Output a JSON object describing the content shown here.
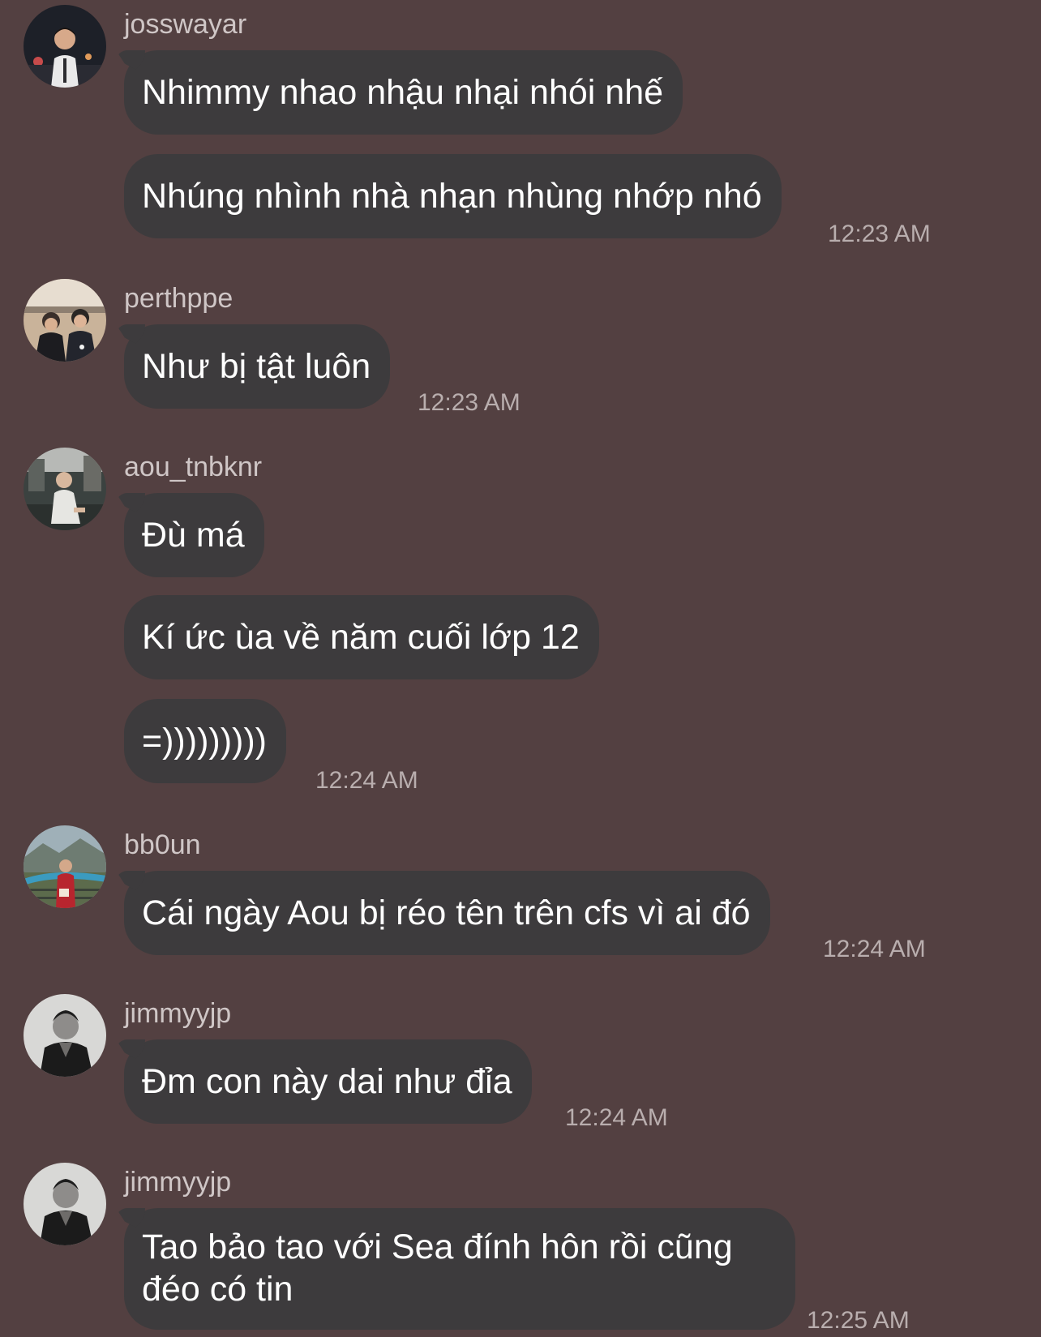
{
  "messages": [
    {
      "sender": "josswayar",
      "avatar": "avatar-josswayar",
      "bubbles": [
        "Nhimmy nhao nhậu nhại nhói nhế",
        "Nhúng nhình nhà nhạn nhùng nhớp nhó"
      ],
      "time": "12:23 AM"
    },
    {
      "sender": "perthppe",
      "avatar": "avatar-perthppe",
      "bubbles": [
        "Như bị tật luôn"
      ],
      "time": "12:23 AM"
    },
    {
      "sender": "aou_tnbknr",
      "avatar": "avatar-aou_tnbknr",
      "bubbles": [
        "Đù má",
        "Kí ức ùa về năm cuối lớp 12",
        "=)))))))))"
      ],
      "time": "12:24 AM"
    },
    {
      "sender": "bb0un",
      "avatar": "avatar-bb0un",
      "bubbles": [
        "Cái ngày Aou bị réo tên trên cfs vì ai đó"
      ],
      "time": "12:24 AM"
    },
    {
      "sender": "jimmyyjp",
      "avatar": "avatar-jimmyyjp",
      "bubbles": [
        "Đm con này dai như đỉa"
      ],
      "time": "12:24 AM"
    },
    {
      "sender": "jimmyyjp",
      "avatar": "avatar-jimmyyjp",
      "bubbles": [
        "Tao bảo tao với Sea đính hôn rồi cũng đéo có tin"
      ],
      "time": "12:25 AM"
    }
  ],
  "colors": {
    "background": "#534041",
    "bubble": "#3d3b3d",
    "text": "#ffffff",
    "meta": "#b9aeae"
  }
}
